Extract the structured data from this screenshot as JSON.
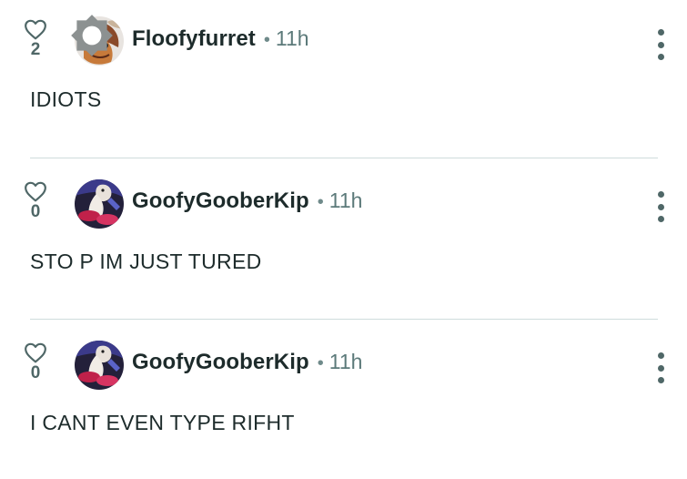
{
  "comments": [
    {
      "username": "Floofyfurret",
      "dot": "•",
      "time": "11h",
      "likes": "2",
      "text": "IDIOTS",
      "avatar_icon": "furret-avatar",
      "has_badge": true
    },
    {
      "username": "GoofyGooberKip",
      "dot": "•",
      "time": "11h",
      "likes": "0",
      "text": "STO P IM JUST TURED",
      "avatar_icon": "kip-avatar",
      "has_badge": false
    },
    {
      "username": "GoofyGooberKip",
      "dot": "•",
      "time": "11h",
      "likes": "0",
      "text": "I CANT EVEN TYPE RIFHT",
      "avatar_icon": "kip-avatar",
      "has_badge": false
    }
  ],
  "colors": {
    "text": "#1d2b2b",
    "muted": "#5c7a7a",
    "divider": "#cfdcdc"
  }
}
